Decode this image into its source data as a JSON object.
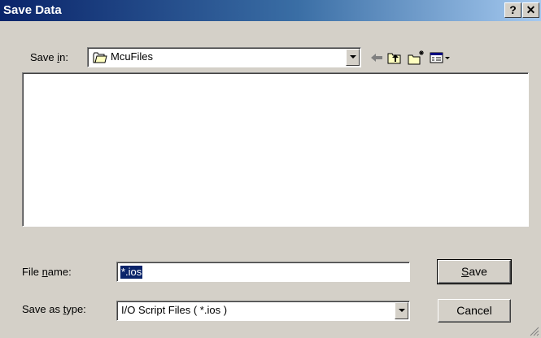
{
  "window": {
    "title": "Save Data",
    "help_button": "?",
    "close_button": "✕"
  },
  "save_in": {
    "label_pre": "Save ",
    "label_mnemonic": "i",
    "label_post": "n:",
    "value": "McuFiles",
    "icon": "folder-icon"
  },
  "toolbar": [
    "back-arrow-icon",
    "up-one-level-icon",
    "new-folder-icon",
    "view-menu-icon"
  ],
  "file_name": {
    "label_pre": "File ",
    "label_mnemonic": "n",
    "label_post": "ame:",
    "value": "*.ios"
  },
  "save_as_type": {
    "label_pre": "Save as ",
    "label_mnemonic": "t",
    "label_post": "ype:",
    "value": "I/O Script Files ( *.ios )"
  },
  "buttons": {
    "save_mnemonic": "S",
    "save_rest": "ave",
    "cancel": "Cancel"
  },
  "colors": {
    "titlebar_start": "#0a246a",
    "titlebar_end": "#a6caf0",
    "face": "#d4d0c8",
    "selection": "#0a246a"
  }
}
